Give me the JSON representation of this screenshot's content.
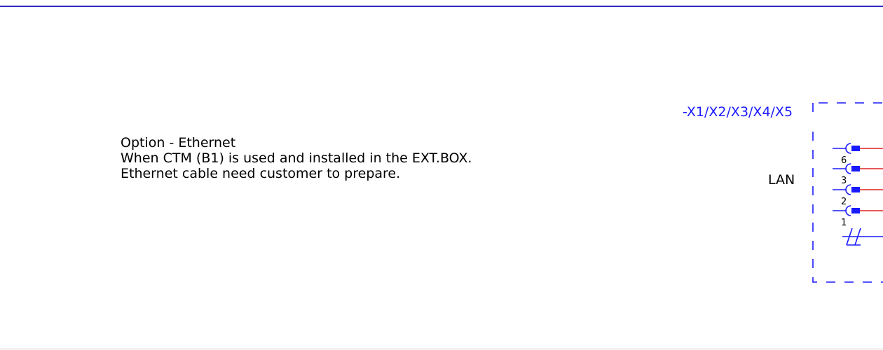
{
  "note": {
    "line1": "Option - Ethernet",
    "line2": "When CTM (B1) is used and installed in the EXT.BOX.",
    "line3": "Ethernet cable need customer to prepare."
  },
  "connector": {
    "tag": "-X1/X2/X3/X4/X5",
    "port_label": "LAN",
    "pins": [
      "6",
      "3",
      "2",
      "1"
    ]
  },
  "colors": {
    "frame": "#1a1aff",
    "pin": "#1a1aff",
    "wire": "#e02020",
    "rule": "#2f2fc8"
  }
}
